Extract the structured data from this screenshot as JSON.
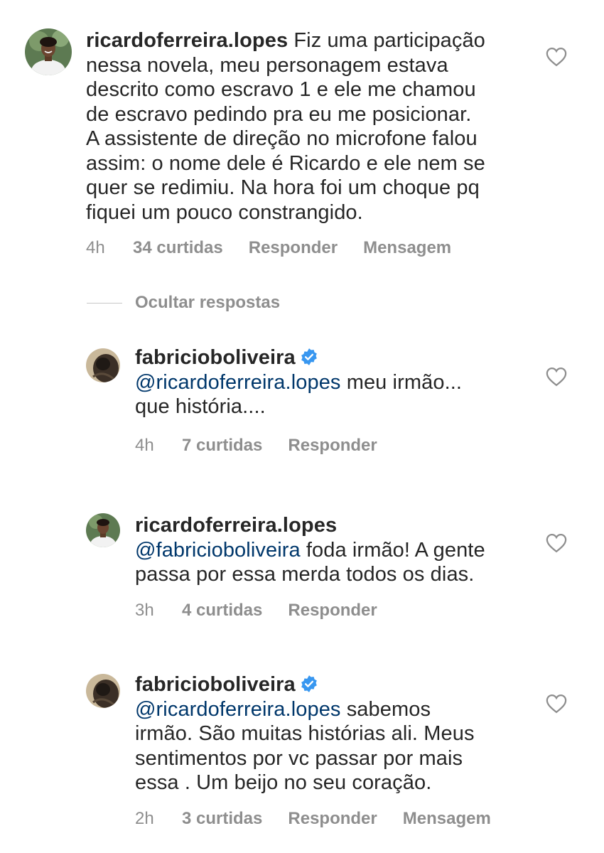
{
  "comments": [
    {
      "username": "ricardoferreira.lopes",
      "text": "Fiz uma participação nessa novela, meu personagem estava descrito como escravo 1 e ele me chamou de escravo pedindo pra eu me posicionar. A assistente de direção no microfone falou assim: o nome dele é Ricardo e ele nem se quer se redimiu. Na hora foi um choque pq fiquei um pouco constrangido.",
      "lines": [
        "nessa novela, meu personagem estava",
        "descrito como escravo 1 e ele me chamou",
        "de escravo pedindo pra eu me posicionar.",
        "A assistente de direção no microfone falou",
        "assim: o nome dele é Ricardo e ele nem se",
        "quer se redimiu. Na hora foi um choque pq",
        "fiquei um pouco constrangido."
      ],
      "first_line_text": "Fiz uma participação",
      "time": "4h",
      "likes": "34 curtidas",
      "reply": "Responder",
      "message": "Mensagem"
    }
  ],
  "hide_replies": "Ocultar respostas",
  "replies": [
    {
      "username": "fabricioboliveira",
      "verified": true,
      "mention": "@ricardoferreira.lopes",
      "line1_rest": " meu irmão...",
      "line2": "que história....",
      "time": "4h",
      "likes": "7 curtidas",
      "reply": "Responder"
    },
    {
      "username": "ricardoferreira.lopes",
      "verified": false,
      "mention": "@fabricioboliveira",
      "line1_rest": " foda irmão! A gente",
      "line2": "passa por essa merda todos os dias.",
      "time": "3h",
      "likes": "4 curtidas",
      "reply": "Responder"
    },
    {
      "username": "fabricioboliveira",
      "verified": true,
      "mention": "@ricardoferreira.lopes",
      "line1_rest": " sabemos",
      "line2": "irmão. São muitas histórias ali. Meus",
      "line3": "sentimentos por vc passar por mais",
      "line4": "essa . Um beijo no seu coração.",
      "time": "2h",
      "likes": "3 curtidas",
      "reply": "Responder",
      "message": "Mensagem"
    }
  ],
  "colors": {
    "text": "#262626",
    "secondary": "#8e8e8e",
    "mention": "#00376b",
    "verified": "#3897f0"
  },
  "icons": {
    "like": "heart-outline-icon",
    "verified": "verified-badge-icon"
  }
}
